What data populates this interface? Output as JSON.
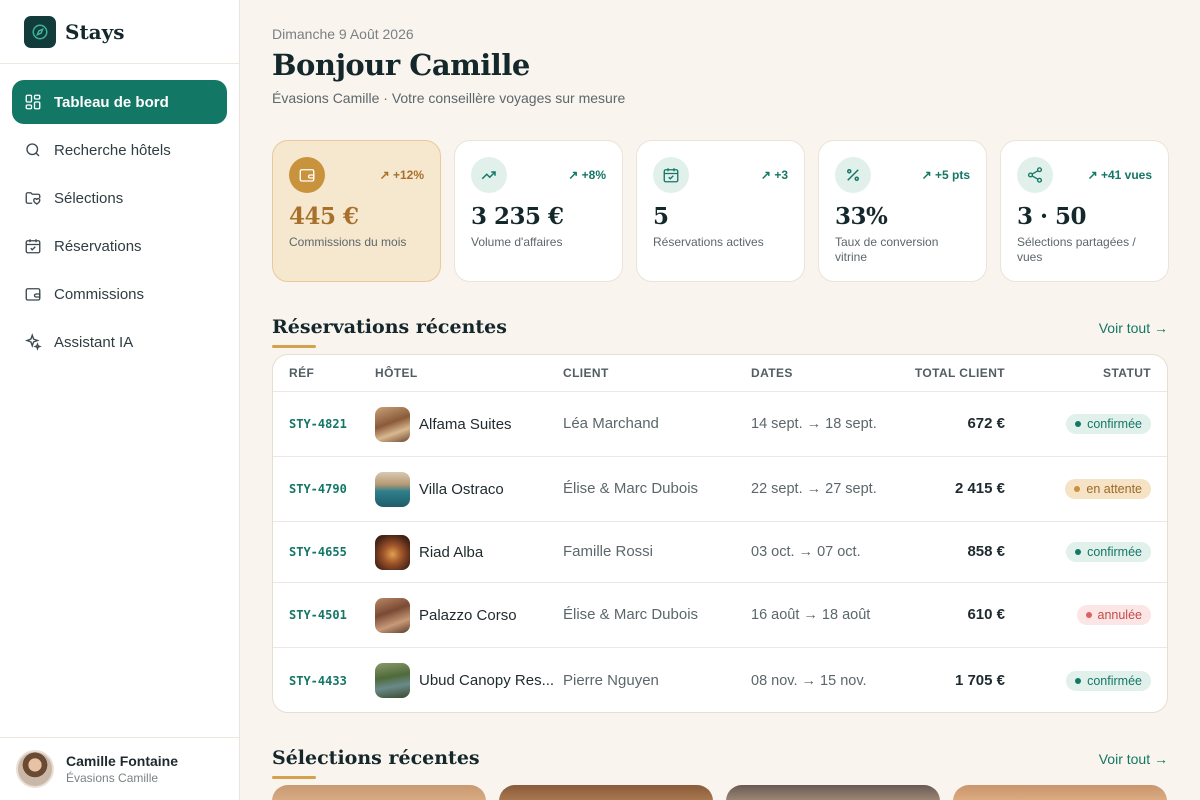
{
  "app": {
    "name": "Stays"
  },
  "sidebar": {
    "items": [
      {
        "label": "Tableau de bord",
        "icon": "dashboard-icon",
        "active": true
      },
      {
        "label": "Recherche hôtels",
        "icon": "search-icon",
        "active": false
      },
      {
        "label": "Sélections",
        "icon": "folder-heart-icon",
        "active": false
      },
      {
        "label": "Réservations",
        "icon": "calendar-check-icon",
        "active": false
      },
      {
        "label": "Commissions",
        "icon": "wallet-icon",
        "active": false
      },
      {
        "label": "Assistant IA",
        "icon": "sparkles-icon",
        "active": false
      }
    ],
    "user": {
      "name": "Camille Fontaine",
      "agency": "Évasions Camille"
    }
  },
  "header": {
    "date": "Dimanche 9 Août 2026",
    "greeting": "Bonjour Camille",
    "subtitle": "Évasions Camille · Votre conseillère voyages sur mesure"
  },
  "kpis": [
    {
      "icon": "wallet-icon",
      "delta": "+12%",
      "value": "445 €",
      "label": "Commissions du mois",
      "highlight": true
    },
    {
      "icon": "trending-up-icon",
      "delta": "+8%",
      "value": "3 235 €",
      "label": "Volume d'affaires"
    },
    {
      "icon": "calendar-check-icon",
      "delta": "+3",
      "value": "5",
      "label": "Réservations actives"
    },
    {
      "icon": "percent-icon",
      "delta": "+5 pts",
      "value": "33%",
      "label": "Taux de conversion vitrine"
    },
    {
      "icon": "share-icon",
      "delta": "+41 vues",
      "value": "3 · 50",
      "label": "Sélections partagées / vues"
    }
  ],
  "reservations": {
    "title": "Réservations récentes",
    "see_all": "Voir tout →",
    "columns": {
      "ref": "RÉF",
      "hotel": "HÔTEL",
      "client": "CLIENT",
      "dates": "DATES",
      "total": "TOTAL CLIENT",
      "status": "STATUT"
    },
    "rows": [
      {
        "ref": "STY-4821",
        "hotel": "Alfama Suites",
        "client": "Léa Marchand",
        "dates": "14 sept. → 18 sept.",
        "total": "672 €",
        "status": "confirmée",
        "status_kind": "confirmed"
      },
      {
        "ref": "STY-4790",
        "hotel": "Villa Ostraco",
        "client": "Élise & Marc Dubois",
        "dates": "22 sept. → 27 sept.",
        "total": "2 415 €",
        "status": "en attente",
        "status_kind": "pending"
      },
      {
        "ref": "STY-4655",
        "hotel": "Riad Alba",
        "client": "Famille Rossi",
        "dates": "03 oct. → 07 oct.",
        "total": "858 €",
        "status": "confirmée",
        "status_kind": "confirmed"
      },
      {
        "ref": "STY-4501",
        "hotel": "Palazzo Corso",
        "client": "Élise & Marc Dubois",
        "dates": "16 août → 18 août",
        "total": "610 €",
        "status": "annulée",
        "status_kind": "cancelled"
      },
      {
        "ref": "STY-4433",
        "hotel": "Ubud Canopy Res...",
        "client": "Pierre Nguyen",
        "dates": "08 nov. → 15 nov.",
        "total": "1 705 €",
        "status": "confirmée",
        "status_kind": "confirmed"
      }
    ]
  },
  "selections": {
    "title": "Sélections récentes",
    "see_all": "Voir tout →"
  },
  "colors": {
    "accent": "#137766",
    "gold": "#c9923c",
    "background": "#faf4ee",
    "confirmed": "#137766",
    "pending": "#c9923c",
    "cancelled": "#d9625f"
  }
}
